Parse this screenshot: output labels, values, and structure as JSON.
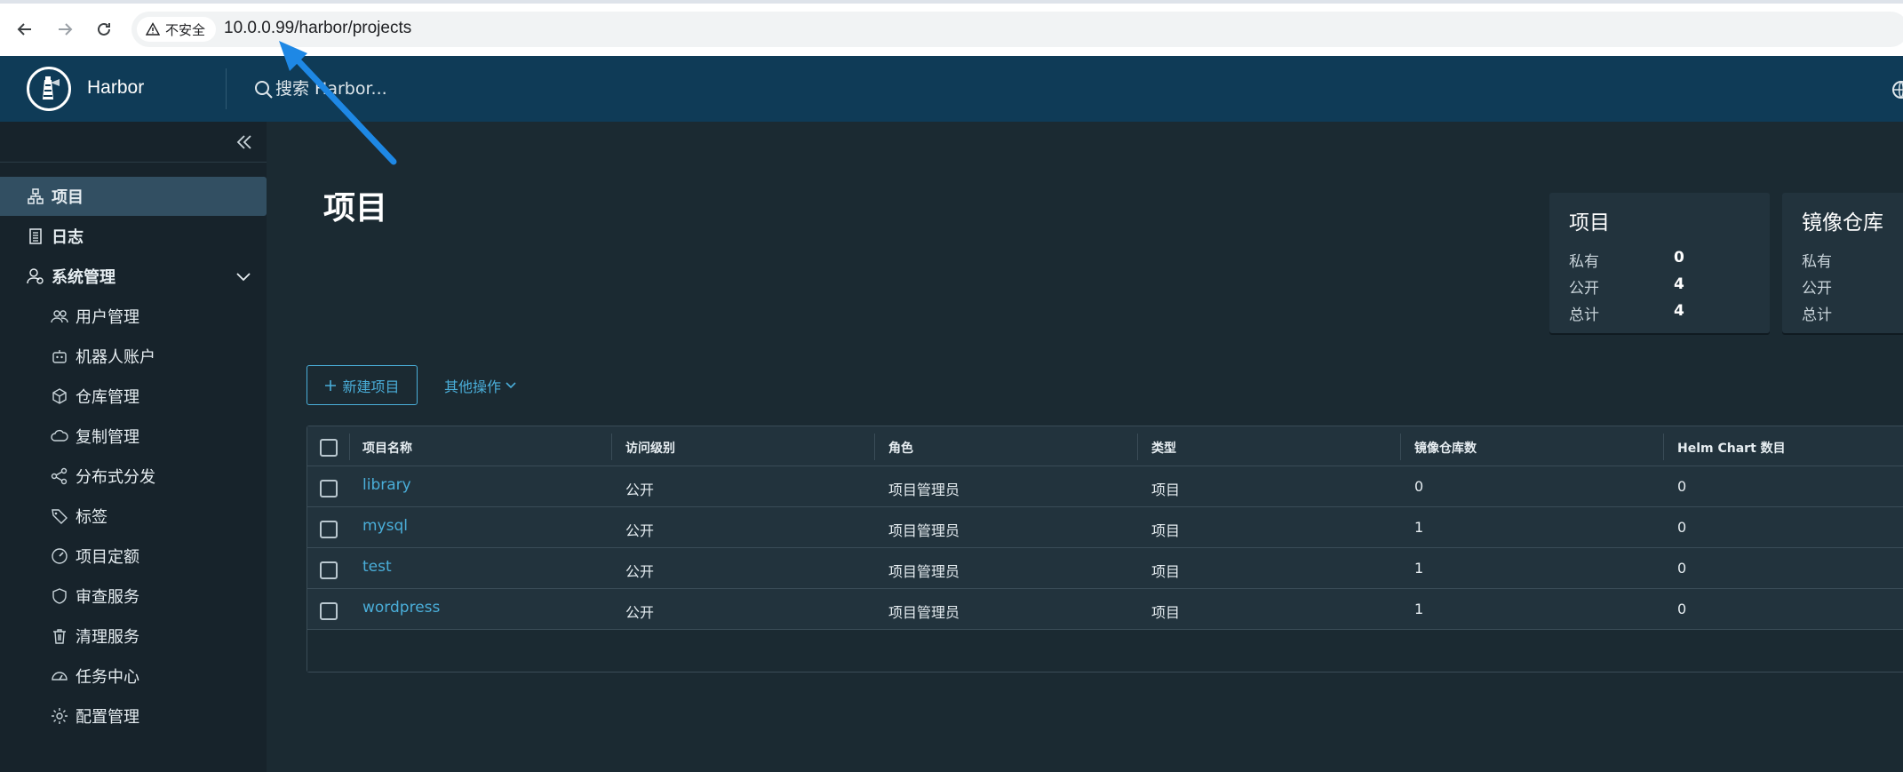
{
  "browser": {
    "security_label": "不安全",
    "url": "10.0.0.99/harbor/projects"
  },
  "header": {
    "app_title": "Harbor",
    "search_placeholder": "搜索 Harbor..."
  },
  "sidebar": {
    "items": [
      {
        "label": "项目"
      },
      {
        "label": "日志"
      },
      {
        "label": "系统管理"
      },
      {
        "label": "用户管理"
      },
      {
        "label": "机器人账户"
      },
      {
        "label": "仓库管理"
      },
      {
        "label": "复制管理"
      },
      {
        "label": "分布式分发"
      },
      {
        "label": "标签"
      },
      {
        "label": "项目定额"
      },
      {
        "label": "审查服务"
      },
      {
        "label": "清理服务"
      },
      {
        "label": "任务中心"
      },
      {
        "label": "配置管理"
      }
    ]
  },
  "main": {
    "title": "项目",
    "cards": [
      {
        "title": "项目",
        "rows": [
          {
            "label": "私有",
            "value": "0"
          },
          {
            "label": "公开",
            "value": "4"
          },
          {
            "label": "总计",
            "value": "4"
          }
        ]
      },
      {
        "title": "镜像仓库",
        "rows": [
          {
            "label": "私有",
            "value": ""
          },
          {
            "label": "公开",
            "value": ""
          },
          {
            "label": "总计",
            "value": ""
          }
        ]
      }
    ],
    "new_project_label": "新建项目",
    "more_actions_label": "其他操作",
    "table": {
      "headers": [
        "项目名称",
        "访问级别",
        "角色",
        "类型",
        "镜像仓库数",
        "Helm Chart 数目"
      ],
      "rows": [
        [
          "library",
          "公开",
          "项目管理员",
          "项目",
          "0",
          "0"
        ],
        [
          "mysql",
          "公开",
          "项目管理员",
          "项目",
          "1",
          "0"
        ],
        [
          "test",
          "公开",
          "项目管理员",
          "项目",
          "1",
          "0"
        ],
        [
          "wordpress",
          "公开",
          "项目管理员",
          "项目",
          "1",
          "0"
        ]
      ]
    }
  },
  "colors": {
    "header_bg": "#0f3b57",
    "sidebar_bg": "#17232b",
    "main_bg": "#1b2a32",
    "accent": "#4aaed9",
    "active_item_bg": "#324f62"
  }
}
